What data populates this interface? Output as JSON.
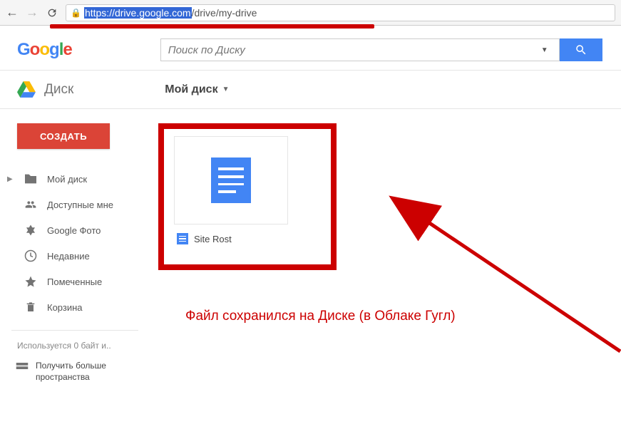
{
  "browser": {
    "url_highlighted": "https://drive.google.com",
    "url_rest": "/drive/my-drive"
  },
  "logo_text": "Google",
  "search": {
    "placeholder": "Поиск по Диску"
  },
  "drive": {
    "app_name": "Диск",
    "breadcrumb": "Мой диск"
  },
  "create_button": "СОЗДАТЬ",
  "nav": {
    "my_drive": "Мой диск",
    "shared": "Доступные мне",
    "photos": "Google Фото",
    "recent": "Недавние",
    "starred": "Помеченные",
    "trash": "Корзина"
  },
  "storage": {
    "usage": "Используется 0 байт и..",
    "upgrade": "Получить больше пространства"
  },
  "file": {
    "name": "Site Rost"
  },
  "annotation": "Файл сохранился на Диске (в Облаке Гугл)"
}
